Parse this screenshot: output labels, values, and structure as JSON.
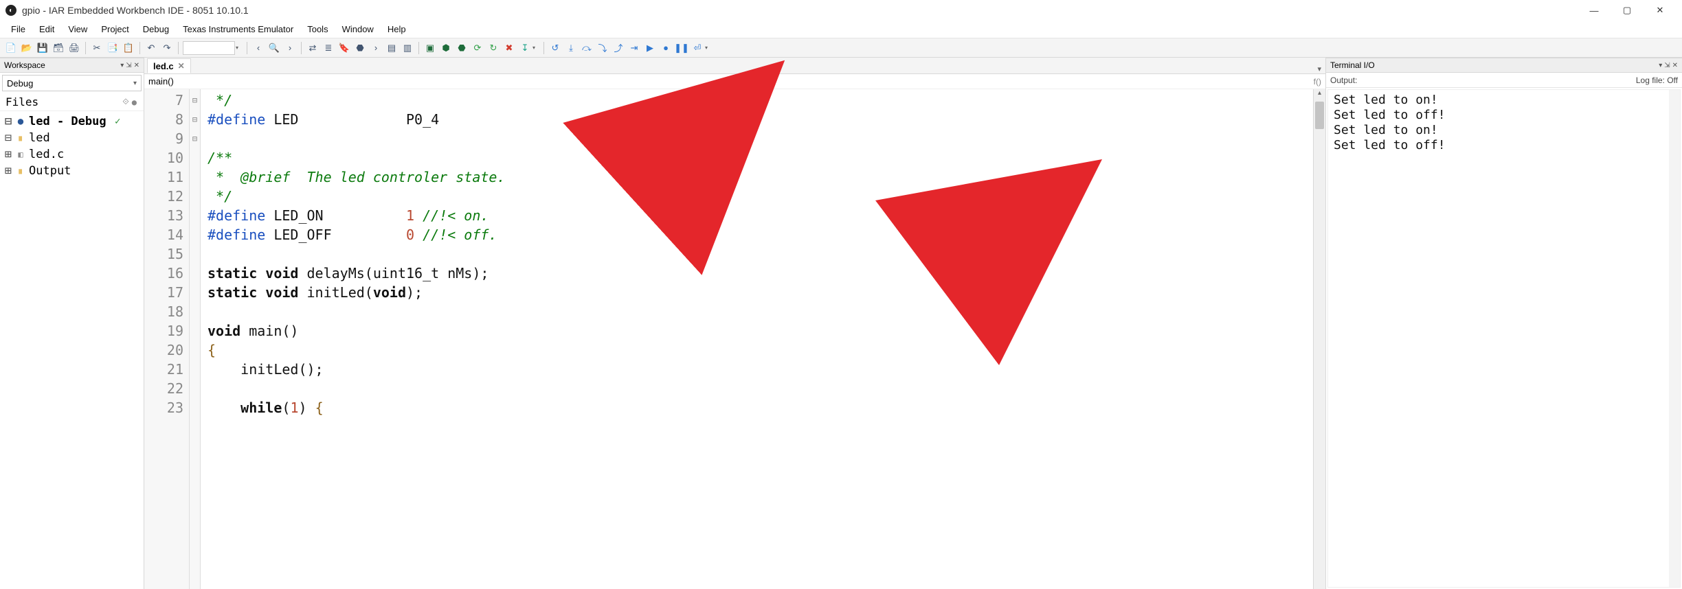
{
  "titlebar": {
    "title": "gpio - IAR Embedded Workbench IDE - 8051 10.10.1"
  },
  "menu": {
    "items": [
      "File",
      "Edit",
      "View",
      "Project",
      "Debug",
      "Texas Instruments Emulator",
      "Tools",
      "Window",
      "Help"
    ]
  },
  "toolbar": {
    "icons1": [
      {
        "name": "new-file-icon",
        "glyph": "📄"
      },
      {
        "name": "open-icon",
        "glyph": "📂"
      },
      {
        "name": "save-icon",
        "glyph": "💾"
      },
      {
        "name": "save-all-icon",
        "glyph": "🗃"
      },
      {
        "name": "print-icon",
        "glyph": "🖨"
      }
    ],
    "icons2": [
      {
        "name": "cut-icon",
        "glyph": "✂"
      },
      {
        "name": "copy-icon",
        "glyph": "📑"
      },
      {
        "name": "paste-icon",
        "glyph": "📋"
      }
    ],
    "icons3": [
      {
        "name": "undo-icon",
        "glyph": "↶"
      },
      {
        "name": "redo-icon",
        "glyph": "↷"
      }
    ],
    "nav": [
      {
        "name": "nav-back-icon",
        "glyph": "‹"
      },
      {
        "name": "find-icon",
        "glyph": "🔍"
      },
      {
        "name": "nav-fwd-icon",
        "glyph": "›"
      }
    ],
    "edit": [
      {
        "name": "replace-icon",
        "glyph": "⇄"
      },
      {
        "name": "goto-icon",
        "glyph": "≣"
      },
      {
        "name": "bookmark-icon",
        "glyph": "🔖"
      },
      {
        "name": "breakpoint-icon",
        "glyph": "⬣"
      },
      {
        "name": "nav-next-icon",
        "glyph": "›"
      },
      {
        "name": "toggle-icon",
        "glyph": "▤"
      },
      {
        "name": "toggle2-icon",
        "glyph": "▥"
      }
    ],
    "build": [
      {
        "name": "compile-icon",
        "glyph": "▣",
        "color": "#1e6c3a"
      },
      {
        "name": "make-icon",
        "glyph": "⬢",
        "color": "#1e6c3a"
      },
      {
        "name": "build-icon",
        "glyph": "⬣",
        "color": "#1e6c3a"
      },
      {
        "name": "restart-icon",
        "glyph": "⟳",
        "color": "#2e9f46"
      },
      {
        "name": "refresh-icon",
        "glyph": "↻",
        "color": "#2e9f46"
      },
      {
        "name": "stop-build-icon",
        "glyph": "✖",
        "color": "#d23b2e"
      },
      {
        "name": "download-icon",
        "glyph": "↧",
        "color": "#16a085"
      }
    ],
    "debug": [
      {
        "name": "reset-icon",
        "glyph": "↺",
        "color": "#2e78d2"
      },
      {
        "name": "break-icon",
        "glyph": "⤓",
        "color": "#2e78d2"
      },
      {
        "name": "step-over-icon",
        "glyph": "⤼",
        "color": "#2e78d2"
      },
      {
        "name": "step-into-icon",
        "glyph": "⤵",
        "color": "#2e78d2"
      },
      {
        "name": "step-out-icon",
        "glyph": "⤴",
        "color": "#2e78d2"
      },
      {
        "name": "next-stmt-icon",
        "glyph": "⇥",
        "color": "#2e78d2"
      },
      {
        "name": "run-to-icon",
        "glyph": "▶",
        "color": "#2e78d2"
      },
      {
        "name": "go-icon",
        "glyph": "●",
        "color": "#2e78d2"
      },
      {
        "name": "pause-icon",
        "glyph": "❚❚",
        "color": "#2e78d2"
      },
      {
        "name": "stop-debug-icon",
        "glyph": "⏎",
        "color": "#2e78d2"
      }
    ]
  },
  "workspace": {
    "panel_title": "Workspace",
    "config": "Debug",
    "files_col": "Files",
    "project_node": "led - Debug",
    "tree": [
      {
        "depth": 0,
        "exp": "⊟",
        "type": "proj",
        "label": "led - Debug",
        "bold": true,
        "check": true
      },
      {
        "depth": 1,
        "exp": "⊟",
        "type": "folder",
        "label": "led"
      },
      {
        "depth": 2,
        "exp": "⊞",
        "type": "file",
        "label": "led.c"
      },
      {
        "depth": 1,
        "exp": "⊞",
        "type": "folder",
        "label": "Output"
      }
    ]
  },
  "editor": {
    "tab": "led.c",
    "crumb": "main()",
    "first_line_no": 7,
    "fold_marks": {
      "10": "⊟",
      "20": "⊟",
      "23": "⊟"
    },
    "lines": [
      {
        "n": 7,
        "html": "<span class='cm'> */</span>"
      },
      {
        "n": 8,
        "html": "<span class='pp'>#define</span> LED             P0_4"
      },
      {
        "n": 9,
        "html": ""
      },
      {
        "n": 10,
        "html": "<span class='cm'>/**</span>"
      },
      {
        "n": 11,
        "html": "<span class='cm'> *  @brief  The led controler state.</span>"
      },
      {
        "n": 12,
        "html": "<span class='cm'> */</span>"
      },
      {
        "n": 13,
        "html": "<span class='pp'>#define</span> LED_ON          <span class='num'>1</span> <span class='cm'>//!< on.</span>"
      },
      {
        "n": 14,
        "html": "<span class='pp'>#define</span> LED_OFF         <span class='num'>0</span> <span class='cm'>//!< off.</span>"
      },
      {
        "n": 15,
        "html": ""
      },
      {
        "n": 16,
        "html": "<span class='kw'>static</span> <span class='kw'>void</span> delayMs(uint16_t nMs);"
      },
      {
        "n": 17,
        "html": "<span class='kw'>static</span> <span class='kw'>void</span> initLed(<span class='kw'>void</span>);"
      },
      {
        "n": 18,
        "html": ""
      },
      {
        "n": 19,
        "html": "<span class='kw'>void</span> main()"
      },
      {
        "n": 20,
        "html": "<span class='br'>{</span>"
      },
      {
        "n": 21,
        "html": "    initLed();"
      },
      {
        "n": 22,
        "html": ""
      },
      {
        "n": 23,
        "html": "    <span class='kw'>while</span>(<span class='num'>1</span>) <span class='br'>{</span>"
      }
    ]
  },
  "terminal": {
    "panel_title": "Terminal I/O",
    "sub_label": "Output:",
    "log_label": "Log file: Off",
    "lines": [
      "Set led to on!",
      "Set led to off!",
      "Set led to on!",
      "Set led to off!"
    ]
  }
}
